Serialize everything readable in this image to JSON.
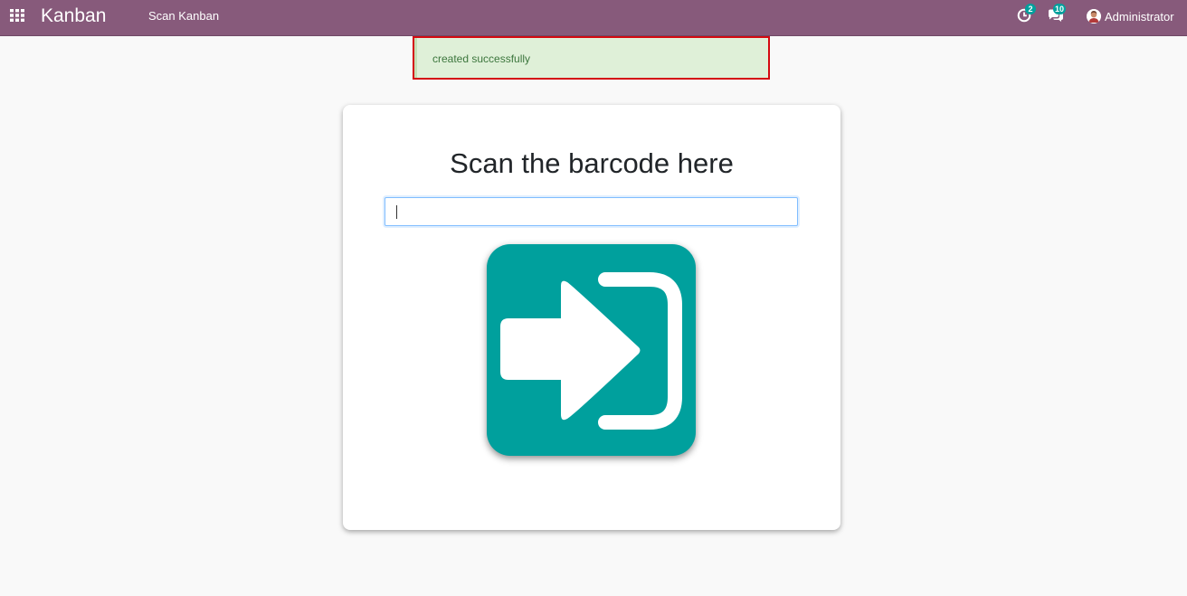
{
  "navbar": {
    "apps_icon": "apps-grid-icon",
    "brand": "Kanban",
    "menu": [
      {
        "label": "Scan Kanban"
      }
    ],
    "activity": {
      "icon": "clock-icon",
      "count": "2"
    },
    "messages": {
      "icon": "chat-bubbles-icon",
      "count": "10"
    },
    "user": {
      "avatar_icon": "user-avatar-icon",
      "name": "Administrator"
    }
  },
  "notification": {
    "message": "created successfully"
  },
  "scan_panel": {
    "title": "Scan the barcode here",
    "input": {
      "value": "",
      "placeholder": ""
    },
    "button_icon": "sign-in-arrow-icon"
  },
  "colors": {
    "navbar": "#875a7b",
    "accent": "#00a09d",
    "alert_bg": "#dff0d8",
    "alert_text": "#3c763d",
    "highlight": "#d40a11"
  }
}
